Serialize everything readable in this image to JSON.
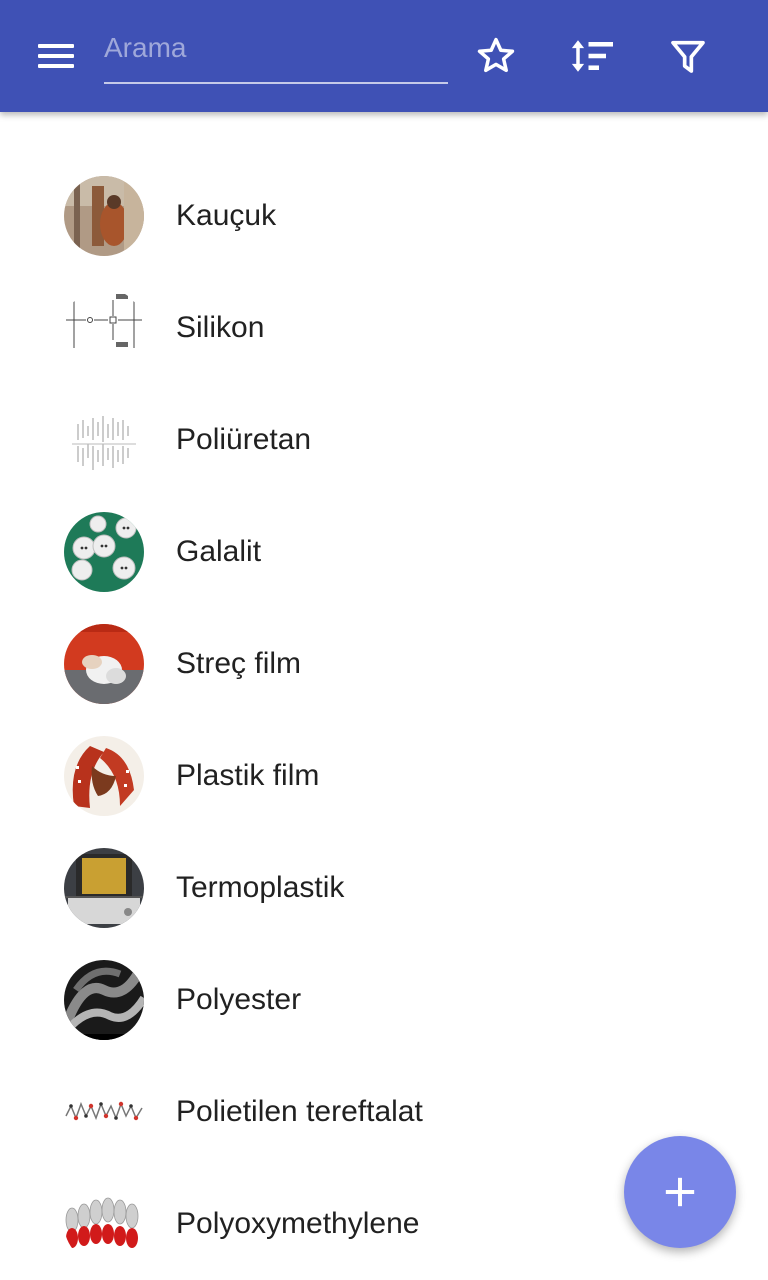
{
  "search": {
    "placeholder": "Arama",
    "value": ""
  },
  "toolbar": {
    "menu_icon": "hamburger-menu-icon",
    "favorite_icon": "star-outline-icon",
    "sort_icon": "sort-icon",
    "filter_icon": "filter-icon"
  },
  "colors": {
    "appbar": "#3f51b5",
    "fab": "#7986e8",
    "text": "#212121"
  },
  "items": [
    {
      "label": "Kauçuk"
    },
    {
      "label": "Silikon"
    },
    {
      "label": "Poliüretan"
    },
    {
      "label": "Galalit"
    },
    {
      "label": "Streç film"
    },
    {
      "label": "Plastik film"
    },
    {
      "label": "Termoplastik"
    },
    {
      "label": "Polyester"
    },
    {
      "label": "Polietilen tereftalat"
    },
    {
      "label": "Polyoxymethylene"
    }
  ],
  "fab": {
    "icon": "plus-icon"
  }
}
